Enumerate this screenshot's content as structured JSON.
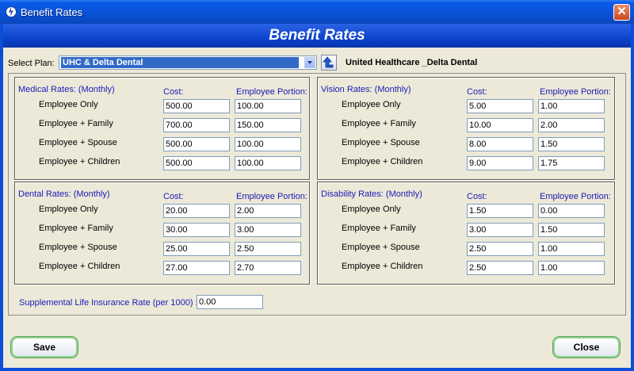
{
  "window": {
    "title": "Benefit Rates",
    "close_glyph": "✕"
  },
  "banner": {
    "title": "Benefit Rates"
  },
  "plan": {
    "label": "Select Plan:",
    "selected": "UHC & Delta Dental",
    "name": "United Healthcare _Delta Dental"
  },
  "column_headers": {
    "cost": "Cost:",
    "employee_portion": "Employee Portion:"
  },
  "groups": {
    "medical": {
      "title": "Medical Rates: (Monthly)",
      "rows": [
        {
          "label": "Employee Only",
          "cost": "500.00",
          "portion": "100.00"
        },
        {
          "label": "Employee + Family",
          "cost": "700.00",
          "portion": "150.00"
        },
        {
          "label": "Employee + Spouse",
          "cost": "500.00",
          "portion": "100.00"
        },
        {
          "label": "Employee + Children",
          "cost": "500.00",
          "portion": "100.00"
        }
      ]
    },
    "vision": {
      "title": "Vision Rates: (Monthly)",
      "rows": [
        {
          "label": "Employee Only",
          "cost": "5.00",
          "portion": "1.00"
        },
        {
          "label": "Employee + Family",
          "cost": "10.00",
          "portion": "2.00"
        },
        {
          "label": "Employee + Spouse",
          "cost": "8.00",
          "portion": "1.50"
        },
        {
          "label": "Employee + Children",
          "cost": "9.00",
          "portion": "1.75"
        }
      ]
    },
    "dental": {
      "title": "Dental Rates: (Monthly)",
      "rows": [
        {
          "label": "Employee Only",
          "cost": "20.00",
          "portion": "2.00"
        },
        {
          "label": "Employee + Family",
          "cost": "30.00",
          "portion": "3.00"
        },
        {
          "label": "Employee + Spouse",
          "cost": "25.00",
          "portion": "2.50"
        },
        {
          "label": "Employee + Children",
          "cost": "27.00",
          "portion": "2.70"
        }
      ]
    },
    "disability": {
      "title": "Disability Rates: (Monthly)",
      "rows": [
        {
          "label": "Employee Only",
          "cost": "1.50",
          "portion": "0.00"
        },
        {
          "label": "Employee + Family",
          "cost": "3.00",
          "portion": "1.50"
        },
        {
          "label": "Employee + Spouse",
          "cost": "2.50",
          "portion": "1.00"
        },
        {
          "label": "Employee + Children",
          "cost": "2.50",
          "portion": "1.00"
        }
      ]
    }
  },
  "supplemental": {
    "label": "Supplemental Life Insurance Rate (per 1000) :",
    "value": "0.00"
  },
  "buttons": {
    "save": "Save",
    "close": "Close"
  },
  "icons": {
    "app": "app-logo-icon",
    "close": "close-icon",
    "dropdown": "chevron-down-icon",
    "nav": "up-arrow-icon"
  }
}
